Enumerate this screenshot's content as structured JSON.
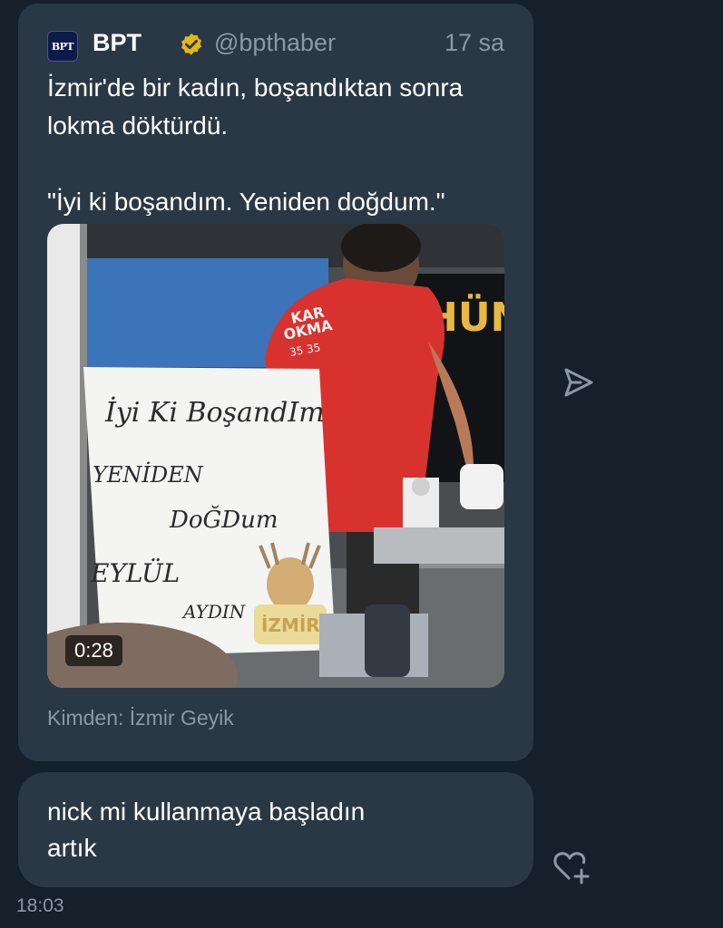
{
  "colors": {
    "background": "#15202b",
    "bubble": "#2a3845",
    "secondary_text": "#8b98a5",
    "verified_badge": "#e2b719"
  },
  "tweet": {
    "logo_text": "BPT",
    "author_name": "BPT",
    "verified_icon": "verified-badge-icon",
    "handle": "@bpthaber",
    "time": "17 sa",
    "paragraphs": [
      "İzmir'de bir kadın, boşandıktan sonra\nlokma döktürdü.",
      "\"İyi ki boşandım. Yeniden doğdum.\""
    ],
    "media": {
      "type": "video",
      "duration": "0:28",
      "sign_lines": [
        "İyi Ki BoşandIm",
        "YENİDEN",
        "DoĞDum",
        "EYLÜL",
        "AYDIN"
      ],
      "shirt_text": [
        "KAR",
        "OKMA",
        "35 35"
      ],
      "banner_text": "HÜN",
      "watermark": "İZMİR"
    },
    "source": "Kimden: İzmir Geyik"
  },
  "share_icon": "share-icon",
  "reply": {
    "text": "nick mi kullanmaya başladın\nartık",
    "reaction_icon": "add-reaction-icon",
    "time": "18:03"
  }
}
